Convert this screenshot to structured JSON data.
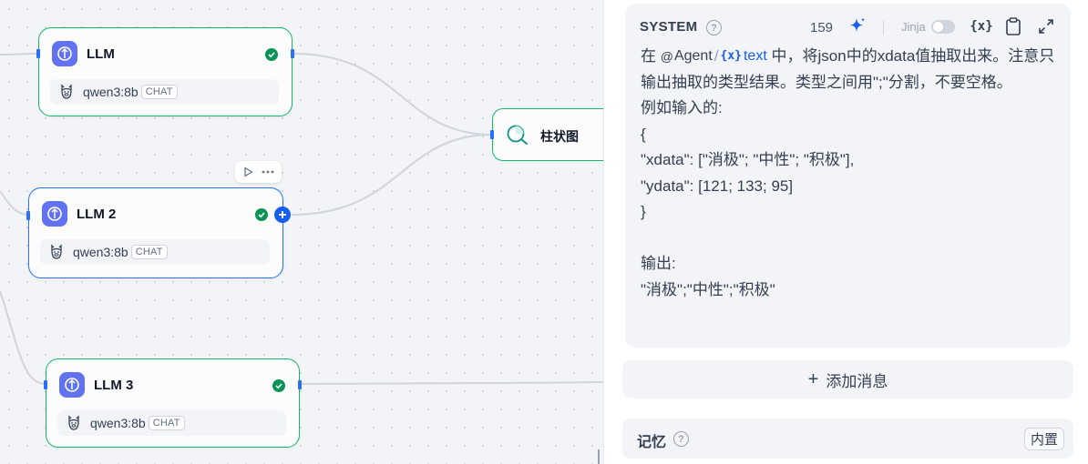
{
  "canvas": {
    "nodes": [
      {
        "id": "llm1",
        "title": "LLM",
        "model": "qwen3:8b",
        "tag": "CHAT",
        "status": "success"
      },
      {
        "id": "llm2",
        "title": "LLM 2",
        "model": "qwen3:8b",
        "tag": "CHAT",
        "status": "success",
        "selected": true
      },
      {
        "id": "llm3",
        "title": "LLM 3",
        "model": "qwen3:8b",
        "tag": "CHAT",
        "status": "success"
      }
    ],
    "chart_node": {
      "title": "柱状图",
      "icon": "chart-tool-icon"
    },
    "node_toolbar": {
      "run_icon": "play-icon",
      "more_icon": "more-icon"
    }
  },
  "panel": {
    "system": {
      "label": "SYSTEM",
      "char_count": "159",
      "jinja_label": "Jinja",
      "jinja_enabled": false,
      "variable_button": "{x}",
      "prompt": {
        "line1_prefix": "在 ",
        "chip_agent": "Agent",
        "chip_sep": "/",
        "chip_var_icon": "{x}",
        "chip_var": "text",
        "line1_suffix": " 中，将json中的xdata值抽取出来。注意只输出抽取的类型结果。类型之间用\";\"分割，不要空格。",
        "body": "\n例如输入的:\n{\n\"xdata\": [\"消极\"; \"中性\"; \"积极\"],\n\"ydata\": [121; 133; 95]\n}\n\n输出:\n\"消极\";\"中性\";\"积极\""
      }
    },
    "add_message": {
      "plus": "+",
      "label": "添加消息"
    },
    "memory": {
      "label": "记忆",
      "badge": "内置"
    }
  },
  "colors": {
    "accent": "#155eef",
    "success": "#079455",
    "node_icon": "#6172f3"
  }
}
